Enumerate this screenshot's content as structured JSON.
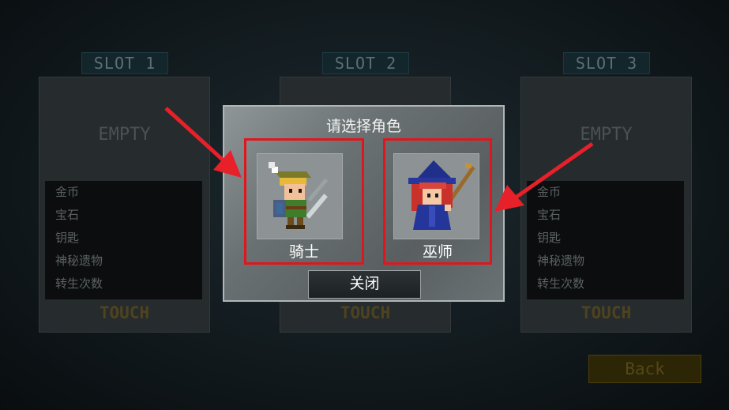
{
  "slots": [
    {
      "header": "SLOT 1",
      "status": "EMPTY",
      "touch": "TOUCH",
      "stats": [
        "金币",
        "宝石",
        "钥匙",
        "神秘遗物",
        "转生次数"
      ]
    },
    {
      "header": "SLOT 2",
      "status": "",
      "touch": "TOUCH",
      "stats": [
        "",
        "",
        "",
        "",
        ""
      ]
    },
    {
      "header": "SLOT 3",
      "status": "EMPTY",
      "touch": "TOUCH",
      "stats": [
        "金币",
        "宝石",
        "钥匙",
        "神秘遗物",
        "转生次数"
      ]
    }
  ],
  "dialog": {
    "title": "请选择角色",
    "characters": [
      {
        "label": "骑士",
        "icon": "knight-icon"
      },
      {
        "label": "巫师",
        "icon": "wizard-icon"
      }
    ],
    "close_label": "关闭"
  },
  "back_label": "Back",
  "colors": {
    "highlight": "#e0161e",
    "arrow": "#e8202a"
  }
}
